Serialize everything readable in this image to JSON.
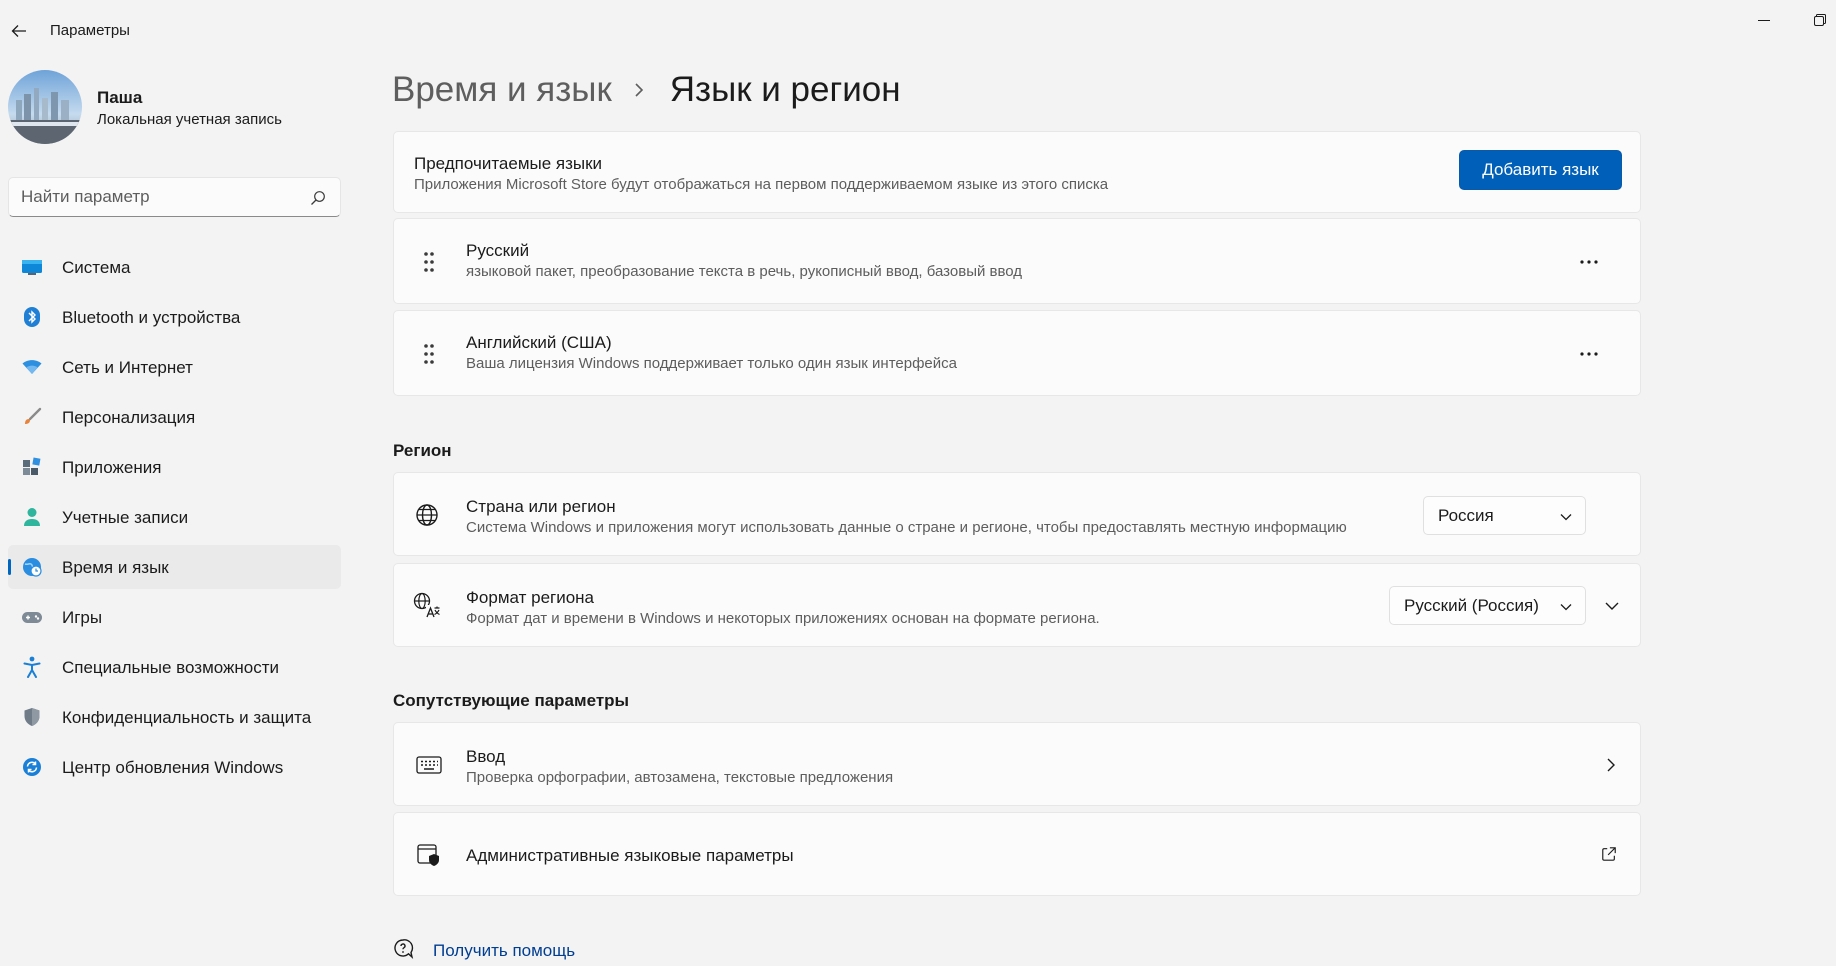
{
  "app": {
    "title": "Параметры"
  },
  "user": {
    "name": "Паша",
    "account_type": "Локальная учетная запись"
  },
  "search": {
    "placeholder": "Найти параметр"
  },
  "sidebar": {
    "items": [
      {
        "label": "Система",
        "icon": "system-icon",
        "active": false
      },
      {
        "label": "Bluetooth и устройства",
        "icon": "bluetooth-icon",
        "active": false
      },
      {
        "label": "Сеть и Интернет",
        "icon": "wifi-icon",
        "active": false
      },
      {
        "label": "Персонализация",
        "icon": "brush-icon",
        "active": false
      },
      {
        "label": "Приложения",
        "icon": "apps-icon",
        "active": false
      },
      {
        "label": "Учетные записи",
        "icon": "person-icon",
        "active": false
      },
      {
        "label": "Время и язык",
        "icon": "globe-clock-icon",
        "active": true
      },
      {
        "label": "Игры",
        "icon": "gamepad-icon",
        "active": false
      },
      {
        "label": "Специальные возможности",
        "icon": "accessibility-icon",
        "active": false
      },
      {
        "label": "Конфиденциальность и защита",
        "icon": "shield-icon",
        "active": false
      },
      {
        "label": "Центр обновления Windows",
        "icon": "update-icon",
        "active": false
      }
    ]
  },
  "breadcrumb": {
    "parent": "Время и язык",
    "current": "Язык и регион"
  },
  "preferred_languages": {
    "title": "Предпочитаемые языки",
    "subtitle": "Приложения Microsoft Store будут отображаться на первом поддерживаемом языке из этого списка",
    "add_button": "Добавить язык",
    "languages": [
      {
        "name": "Русский",
        "details": "языковой пакет, преобразование текста в речь, рукописный ввод, базовый ввод"
      },
      {
        "name": "Английский (США)",
        "details": "Ваша лицензия Windows поддерживает только один язык интерфейса"
      }
    ]
  },
  "region": {
    "section_title": "Регион",
    "country": {
      "title": "Страна или регион",
      "subtitle": "Система Windows и приложения могут использовать данные о стране и регионе, чтобы предоставлять местную информацию",
      "value": "Россия"
    },
    "format": {
      "title": "Формат региона",
      "subtitle": "Формат дат и времени в Windows и некоторых приложениях основан на формате региона.",
      "value": "Русский (Россия)"
    }
  },
  "related": {
    "section_title": "Сопутствующие параметры",
    "typing": {
      "title": "Ввод",
      "subtitle": "Проверка орфографии, автозамена, текстовые предложения"
    },
    "admin": {
      "title": "Административные языковые параметры"
    }
  },
  "help": {
    "label": "Получить помощь"
  },
  "colors": {
    "accent": "#005fb8",
    "active_indicator": "#0067c0",
    "link": "#003e92",
    "background": "#f3f3f3"
  }
}
